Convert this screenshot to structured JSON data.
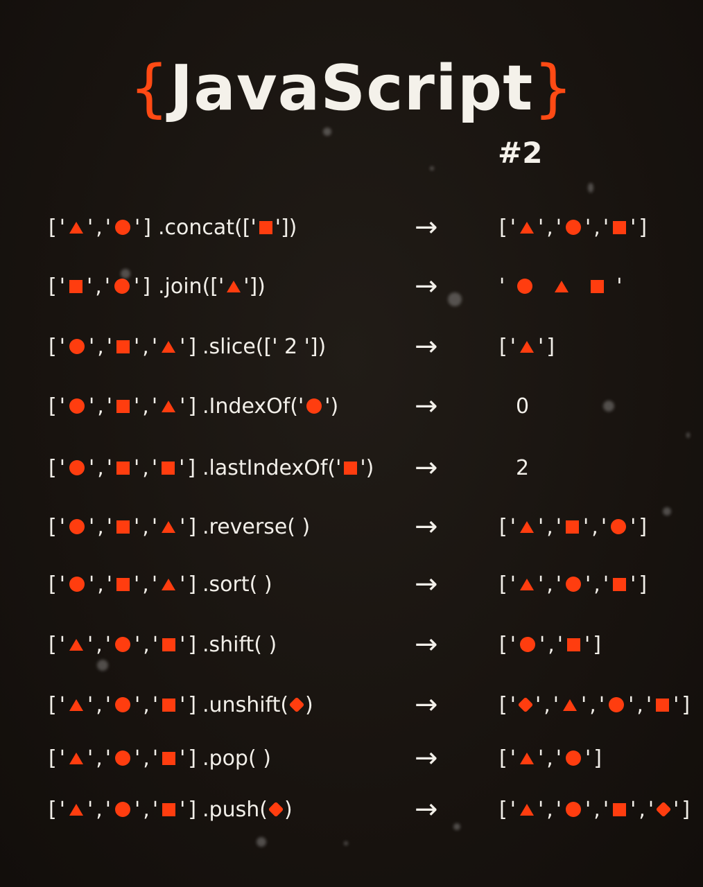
{
  "header": {
    "brace_open": "{",
    "title": "JavaScript",
    "brace_close": "}",
    "subtitle": "#2"
  },
  "colors": {
    "accent": "#ff3d0f",
    "text": "#f4f1ea",
    "background": "#18130f"
  },
  "arrow_symbol": "→",
  "rows": [
    {
      "input": [
        "triangle",
        "circle"
      ],
      "method": ".concat(['",
      "method_arg": [
        "square"
      ],
      "method_end": "'])",
      "result": {
        "type": "array",
        "items": [
          "triangle",
          "circle",
          "square"
        ]
      }
    },
    {
      "input": [
        "square",
        "circle"
      ],
      "method": ".join(['",
      "method_arg": [
        "triangle"
      ],
      "method_end": "'])",
      "result": {
        "type": "string",
        "items": [
          "circle",
          "triangle",
          "square"
        ]
      }
    },
    {
      "input": [
        "circle",
        "square",
        "triangle"
      ],
      "method": ".slice([' 2 '])",
      "method_arg": [],
      "method_end": "",
      "result": {
        "type": "array",
        "items": [
          "triangle"
        ]
      }
    },
    {
      "input": [
        "circle",
        "square",
        "triangle"
      ],
      "method": ".IndexOf('",
      "method_arg": [
        "circle"
      ],
      "method_end": "')",
      "result": {
        "type": "number",
        "value": "0"
      }
    },
    {
      "input": [
        "circle",
        "square",
        "square"
      ],
      "method": ".lastIndexOf('",
      "method_arg": [
        "square"
      ],
      "method_end": "')",
      "result": {
        "type": "number",
        "value": "2"
      }
    },
    {
      "input": [
        "circle",
        "square",
        "triangle"
      ],
      "method": ".reverse( )",
      "method_arg": [],
      "method_end": "",
      "result": {
        "type": "array",
        "items": [
          "triangle",
          "square",
          "circle"
        ]
      }
    },
    {
      "input": [
        "circle",
        "square",
        "triangle"
      ],
      "method": ".sort( )",
      "method_arg": [],
      "method_end": "",
      "result": {
        "type": "array",
        "items": [
          "triangle",
          "circle",
          "square"
        ]
      }
    },
    {
      "input": [
        "triangle",
        "circle",
        "square"
      ],
      "method": ".shift( )",
      "method_arg": [],
      "method_end": "",
      "result": {
        "type": "array",
        "items": [
          "circle",
          "square"
        ]
      }
    },
    {
      "input": [
        "triangle",
        "circle",
        "square"
      ],
      "method": ".unshift( ",
      "method_arg": [
        "diamond"
      ],
      "method_end": ")",
      "result": {
        "type": "array",
        "items": [
          "diamond",
          "triangle",
          "circle",
          "square"
        ]
      }
    },
    {
      "input": [
        "triangle",
        "circle",
        "square"
      ],
      "method": ".pop( )",
      "method_arg": [],
      "method_end": "",
      "result": {
        "type": "array",
        "items": [
          "triangle",
          "circle"
        ]
      }
    },
    {
      "input": [
        "triangle",
        "circle",
        "square"
      ],
      "method": ".push( ",
      "method_arg": [
        "diamond"
      ],
      "method_end": ")",
      "result": {
        "type": "array",
        "items": [
          "triangle",
          "circle",
          "square",
          "diamond"
        ]
      }
    }
  ]
}
